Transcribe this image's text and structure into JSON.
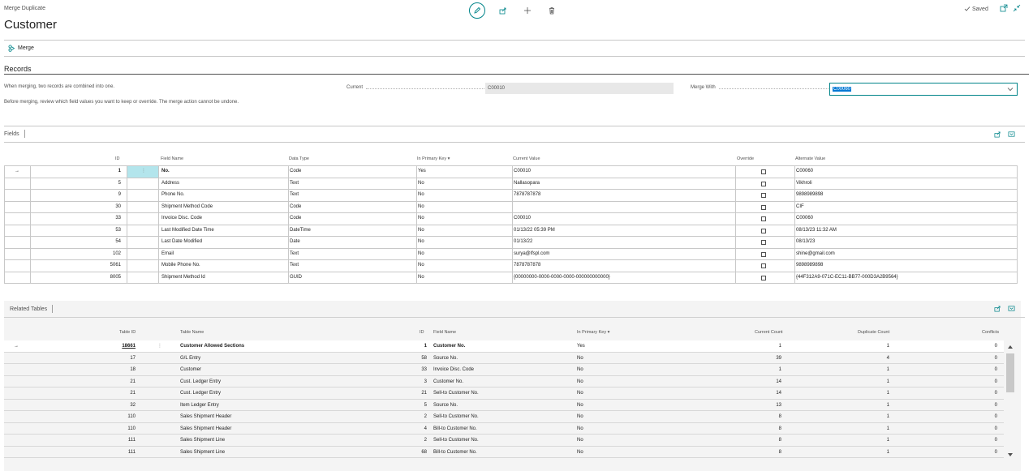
{
  "header": {
    "breadcrumb": "Merge Duplicate",
    "title": "Customer",
    "saved": "Saved"
  },
  "actions": {
    "merge_label": "Merge"
  },
  "records": {
    "title": "Records",
    "info1": "When merging, two records are combined into one.",
    "info2": "Before merging, review which field values you want to keep or override. The merge action cannot be undone.",
    "current_label": "Current",
    "current_value": "C00010",
    "merge_with_label": "Merge With",
    "merge_with_value": "C00060"
  },
  "fields": {
    "title": "Fields",
    "columns": [
      "ID",
      "Field Name",
      "Data Type",
      "In Primary Key",
      "Current Value",
      "Override",
      "Alternate Value"
    ],
    "rows": [
      {
        "id": "1",
        "name": "No.",
        "type": "Code",
        "pk": "Yes",
        "current": "C00010",
        "alt": "C00060"
      },
      {
        "id": "5",
        "name": "Address",
        "type": "Text",
        "pk": "No",
        "current": "Nallasopara",
        "alt": "Vikhroli"
      },
      {
        "id": "9",
        "name": "Phone No.",
        "type": "Text",
        "pk": "No",
        "current": "7878787878",
        "alt": "9898989898"
      },
      {
        "id": "30",
        "name": "Shipment Method Code",
        "type": "Code",
        "pk": "No",
        "current": "",
        "alt": "CIF"
      },
      {
        "id": "33",
        "name": "Invoice Disc. Code",
        "type": "Code",
        "pk": "No",
        "current": "C00010",
        "alt": "C00060"
      },
      {
        "id": "53",
        "name": "Last Modified Date Time",
        "type": "DateTime",
        "pk": "No",
        "current": "01/13/22 05:39 PM",
        "alt": "08/13/23 11:32 AM"
      },
      {
        "id": "54",
        "name": "Last Date Modified",
        "type": "Date",
        "pk": "No",
        "current": "01/13/22",
        "alt": "08/13/23"
      },
      {
        "id": "102",
        "name": "Email",
        "type": "Text",
        "pk": "No",
        "current": "surya@lfspl.com",
        "alt": "shine@gmail.com"
      },
      {
        "id": "5061",
        "name": "Mobile Phone No.",
        "type": "Text",
        "pk": "No",
        "current": "7878787878",
        "alt": "9898989898"
      },
      {
        "id": "8005",
        "name": "Shipment Method Id",
        "type": "GUID",
        "pk": "No",
        "current": "{00000000-0000-0000-0000-000000000000}",
        "alt": "{44F312A9-071C-EC11-BB77-000D3A2B9564}"
      }
    ]
  },
  "related": {
    "title": "Related Tables",
    "columns": [
      "Table ID",
      "Table Name",
      "ID",
      "Field Name",
      "In Primary Key",
      "Current Count",
      "Duplicate Count",
      "Conflicts"
    ],
    "rows": [
      {
        "tid": "18661",
        "tname": "Customer Allowed Sections",
        "fid": "1",
        "fname": "Customer No.",
        "pk": "Yes",
        "cc": "1",
        "dc": "1",
        "conf": "0"
      },
      {
        "tid": "17",
        "tname": "G/L Entry",
        "fid": "58",
        "fname": "Source No.",
        "pk": "No",
        "cc": "39",
        "dc": "4",
        "conf": "0"
      },
      {
        "tid": "18",
        "tname": "Customer",
        "fid": "33",
        "fname": "Invoice Disc. Code",
        "pk": "No",
        "cc": "1",
        "dc": "1",
        "conf": "0"
      },
      {
        "tid": "21",
        "tname": "Cust. Ledger Entry",
        "fid": "3",
        "fname": "Customer No.",
        "pk": "No",
        "cc": "14",
        "dc": "1",
        "conf": "0"
      },
      {
        "tid": "21",
        "tname": "Cust. Ledger Entry",
        "fid": "21",
        "fname": "Sell-to Customer No.",
        "pk": "No",
        "cc": "14",
        "dc": "1",
        "conf": "0"
      },
      {
        "tid": "32",
        "tname": "Item Ledger Entry",
        "fid": "5",
        "fname": "Source No.",
        "pk": "No",
        "cc": "13",
        "dc": "1",
        "conf": "0"
      },
      {
        "tid": "110",
        "tname": "Sales Shipment Header",
        "fid": "2",
        "fname": "Sell-to Customer No.",
        "pk": "No",
        "cc": "8",
        "dc": "1",
        "conf": "0"
      },
      {
        "tid": "110",
        "tname": "Sales Shipment Header",
        "fid": "4",
        "fname": "Bill-to Customer No.",
        "pk": "No",
        "cc": "8",
        "dc": "1",
        "conf": "0"
      },
      {
        "tid": "111",
        "tname": "Sales Shipment Line",
        "fid": "2",
        "fname": "Sell-to Customer No.",
        "pk": "No",
        "cc": "8",
        "dc": "1",
        "conf": "0"
      },
      {
        "tid": "111",
        "tname": "Sales Shipment Line",
        "fid": "68",
        "fname": "Bill-to Customer No.",
        "pk": "No",
        "cc": "8",
        "dc": "1",
        "conf": "0"
      }
    ]
  },
  "colors": {
    "accent": "#008489",
    "selection": "#0078d4",
    "highlight_cell": "#b3e5ec"
  }
}
